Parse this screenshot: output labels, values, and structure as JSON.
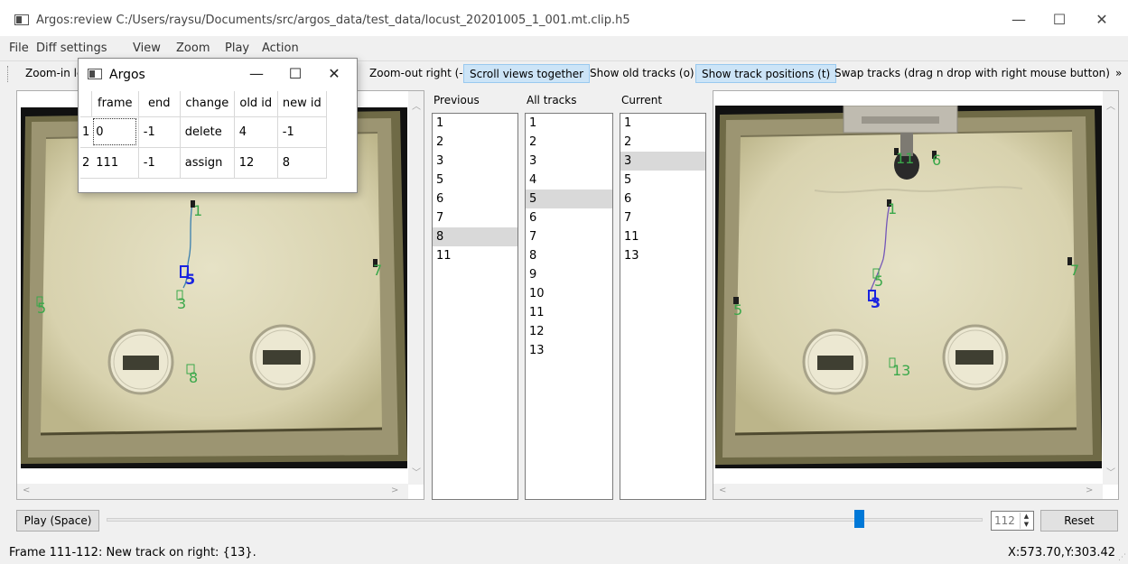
{
  "window": {
    "title": "Argos:review C:/Users/raysu/Documents/src/argos_data/test_data/locust_20201005_1_001.mt.clip.h5",
    "controls": {
      "minimize": "—",
      "maximize": "☐",
      "close": "✕"
    }
  },
  "menu": [
    {
      "label": "File"
    },
    {
      "label": "Diff settings"
    },
    {
      "label": "View"
    },
    {
      "label": "Zoom"
    },
    {
      "label": "Play"
    },
    {
      "label": "Action"
    }
  ],
  "toolbar": {
    "items": [
      {
        "label": "Zoom-in le",
        "active": false
      },
      {
        "label": "Zoom-out right (-)",
        "active": false
      },
      {
        "label": "Scroll views together",
        "active": true
      },
      {
        "label": "Show old tracks (o)",
        "active": false
      },
      {
        "label": "Show track positions (t)",
        "active": true
      },
      {
        "label": "Swap tracks (drag n drop with right mouse button)",
        "active": false
      }
    ],
    "overflow": "»"
  },
  "dialog": {
    "title": "Argos",
    "controls": {
      "minimize": "—",
      "maximize": "☐",
      "close": "✕"
    },
    "columns": [
      "frame",
      "end",
      "change",
      "old id",
      "new id"
    ],
    "rows": [
      {
        "num": "1",
        "cells": [
          "0",
          "-1",
          "delete",
          "4",
          "-1"
        ]
      },
      {
        "num": "2",
        "cells": [
          "111",
          "-1",
          "assign",
          "12",
          "8"
        ]
      }
    ]
  },
  "lists": {
    "previous": {
      "label": "Previous",
      "items": [
        "1",
        "2",
        "3",
        "5",
        "6",
        "7",
        "8",
        "11"
      ],
      "selected": "8"
    },
    "all": {
      "label": "All tracks",
      "items": [
        "1",
        "2",
        "3",
        "4",
        "5",
        "6",
        "7",
        "8",
        "9",
        "10",
        "11",
        "12",
        "13"
      ],
      "selected": "5"
    },
    "current": {
      "label": "Current",
      "items": [
        "1",
        "2",
        "3",
        "5",
        "6",
        "7",
        "11",
        "13"
      ],
      "selected": "3"
    }
  },
  "left_view": {
    "labels": [
      {
        "text": "1",
        "color": "#3aa84a"
      },
      {
        "text": "5",
        "color": "#1a24e0"
      },
      {
        "text": "3",
        "color": "#3aa84a"
      },
      {
        "text": "7",
        "color": "#3aa84a"
      },
      {
        "text": "5",
        "color": "#3aa84a"
      },
      {
        "text": "8",
        "color": "#3aa84a"
      }
    ]
  },
  "right_view": {
    "labels": [
      {
        "text": "11",
        "color": "#3aa84a"
      },
      {
        "text": "6",
        "color": "#3aa84a"
      },
      {
        "text": "1",
        "color": "#3aa84a"
      },
      {
        "text": "5",
        "color": "#3aa84a"
      },
      {
        "text": "7",
        "color": "#3aa84a"
      },
      {
        "text": "3",
        "color": "#1a24e0"
      },
      {
        "text": "5",
        "color": "#3aa84a"
      },
      {
        "text": "13",
        "color": "#3aa84a"
      }
    ]
  },
  "controls": {
    "play_label": "Play (Space)",
    "frame_value": "112",
    "reset_label": "Reset",
    "slider_position": 0.85
  },
  "status": {
    "message": "Frame 111-112: New track on right: {13}.",
    "coords": "X:573.70,Y:303.42"
  },
  "colors": {
    "track_label": "#3aa84a",
    "selected_track": "#1a24e0",
    "toolbar_active": "#cce4f7",
    "slider": "#0078d7"
  }
}
